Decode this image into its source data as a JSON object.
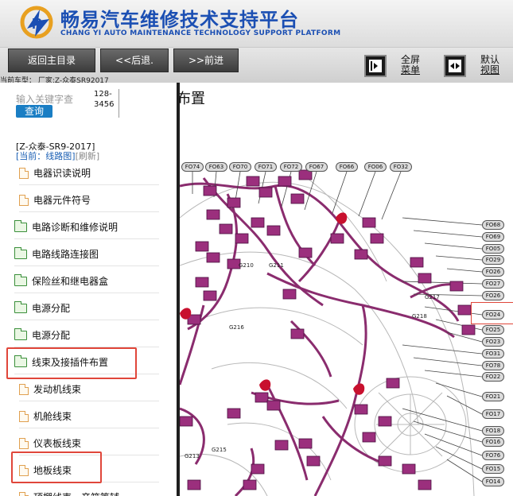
{
  "header": {
    "title_cn": "畅易汽车维修技术支持平台",
    "title_en": "CHANG YI AUTO MAINTENANCE TECHNOLOGY SUPPORT PLATFORM"
  },
  "toolbar": {
    "back_main": "返回主目录",
    "back": "<<后退.",
    "forward": ">>前进",
    "fullscreen_line1": "全屏",
    "fullscreen_line2": "菜单",
    "default_line1": "默认",
    "default_line2": "视图"
  },
  "current_model_label": "当前车型： 厂家:Z-众泰SR92017",
  "search": {
    "placeholder": "输入关键字查",
    "button": "查询",
    "code_line1": "128-",
    "code_line2": "3456"
  },
  "model_line": "[Z-众泰-SR9-2017]",
  "current": {
    "label": "[当前：线路图]",
    "refresh": "[刷新]"
  },
  "tree": [
    {
      "label": "电器识读说明",
      "icon": "document-icon"
    },
    {
      "label": "电器元件符号",
      "icon": "document-icon"
    },
    {
      "label": "电路诊断和维修说明",
      "icon": "folder-icon"
    },
    {
      "label": "电路线路连接图",
      "icon": "folder-icon"
    },
    {
      "label": "保险丝和继电器盒",
      "icon": "folder-icon"
    },
    {
      "label": "电源分配",
      "icon": "folder-icon"
    },
    {
      "label": "电源分配",
      "icon": "folder-icon"
    },
    {
      "label": "线束及接插件布置",
      "icon": "folder-open-icon"
    },
    {
      "label": "发动机线束",
      "icon": "document-icon"
    },
    {
      "label": "机舱线束",
      "icon": "document-icon"
    },
    {
      "label": "仪表板线束",
      "icon": "document-icon"
    },
    {
      "label": "地板线束",
      "icon": "document-icon"
    },
    {
      "label": "顶棚线束、音箱等辅",
      "icon": "document-icon"
    }
  ],
  "diagram": {
    "title": "布置",
    "top_connectors": [
      "FO74",
      "FO63",
      "FO70",
      "FO71",
      "FO72",
      "FO67",
      "FO66",
      "FO06",
      "FO32"
    ],
    "right_connectors": [
      "FO68",
      "FO69",
      "FO05",
      "FO29",
      "FO26",
      "FO27",
      "FO26",
      "FO24",
      "FO25",
      "FO23",
      "FO31",
      "FO78",
      "FO22",
      "FO21",
      "FO17",
      "FO18",
      "FO16",
      "FO76",
      "FO15",
      "FO14"
    ],
    "ground_labels": [
      "G210",
      "G211",
      "G217",
      "G218",
      "G216",
      "G213",
      "G215"
    ],
    "colors": {
      "harness": "#8a2c6e",
      "connector": "#9b2f7d",
      "highlight": "#e0463a"
    }
  }
}
